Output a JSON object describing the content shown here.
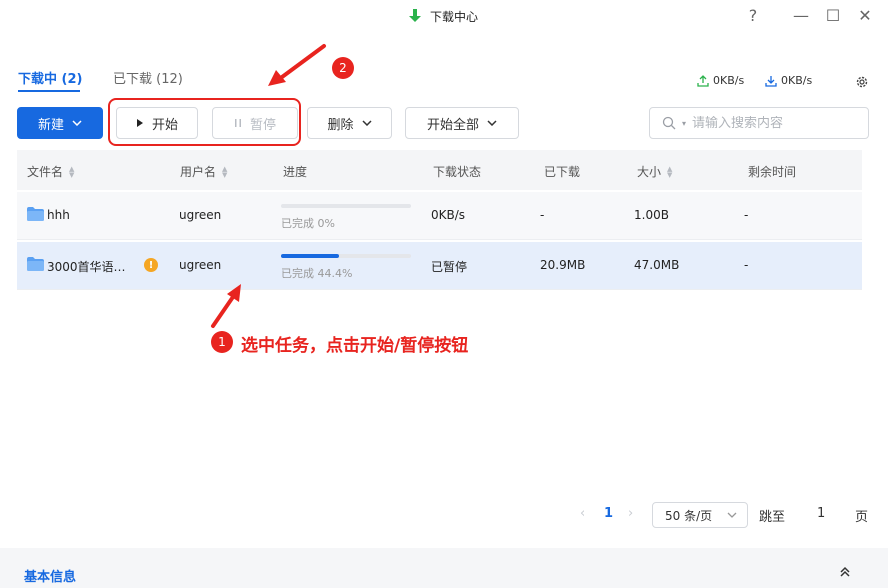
{
  "window": {
    "title": "下载中心",
    "help_glyph": "?",
    "minimize_glyph": "—",
    "maximize_glyph": "☐",
    "close_glyph": "✕"
  },
  "tabs": [
    {
      "label": "下载中 (2)",
      "active": true
    },
    {
      "label": "已下载 (12)",
      "active": false
    }
  ],
  "speeds": {
    "upload": "0KB/s",
    "download": "0KB/s"
  },
  "toolbar": {
    "new_label": "新建",
    "start_label": "开始",
    "pause_label": "暂停",
    "delete_label": "删除",
    "start_all_label": "开始全部",
    "search_placeholder": "请输入搜索内容"
  },
  "table": {
    "columns": [
      "文件名",
      "用户名",
      "进度",
      "下载状态",
      "已下载",
      "大小",
      "剩余时间"
    ],
    "rows": [
      {
        "name": "hhh",
        "user": "ugreen",
        "progress_text": "已完成 0%",
        "progress": 0,
        "status": "0KB/s",
        "downloaded": "-",
        "size": "1.00B",
        "remaining": "-",
        "warning": false
      },
      {
        "name": "3000首华语…",
        "user": "ugreen",
        "progress_text": "已完成 44.4%",
        "progress": 44.4,
        "status": "已暂停",
        "downloaded": "20.9MB",
        "size": "47.0MB",
        "remaining": "-",
        "warning": true,
        "warning_glyph": "!"
      }
    ]
  },
  "annotations": {
    "step1_number": "1",
    "step1_text": "选中任务，点击开始/暂停按钮",
    "step2_number": "2"
  },
  "pagination": {
    "current_page": "1",
    "page_size": "50 条/页",
    "goto_label": "跳至",
    "goto_value": "1",
    "page_suffix": "页"
  },
  "footer": {
    "title": "基本信息"
  },
  "colors": {
    "accent": "#1769e0",
    "annotation": "#e8241f",
    "warning": "#f5a623"
  }
}
